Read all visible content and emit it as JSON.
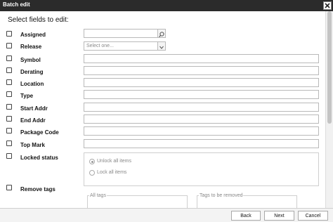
{
  "window": {
    "title": "Batch edit"
  },
  "dialog": {
    "heading": "Select fields to edit:"
  },
  "fields": [
    {
      "label": "Assigned",
      "value": ""
    },
    {
      "label": "Release",
      "placeholder": "Select one..."
    },
    {
      "label": "Symbol",
      "value": ""
    },
    {
      "label": "Derating",
      "value": ""
    },
    {
      "label": "Location",
      "value": ""
    },
    {
      "label": "Type",
      "value": ""
    },
    {
      "label": "Start Addr",
      "value": ""
    },
    {
      "label": "End Addr",
      "value": ""
    },
    {
      "label": "Package Code",
      "value": ""
    },
    {
      "label": "Top Mark",
      "value": ""
    },
    {
      "label": "Locked status"
    },
    {
      "label": "Remove tags"
    }
  ],
  "locked_status": {
    "options": [
      {
        "label": "Unlock all items",
        "selected": true
      },
      {
        "label": "Lock all items",
        "selected": false
      }
    ]
  },
  "tags": {
    "all_tags_label": "All tags",
    "to_remove_label": "Tags to be removed"
  },
  "footer": {
    "back_label": "Back",
    "next_label": "Next",
    "cancel_label": "Cancel"
  },
  "icons": {
    "close": "close-icon",
    "search": "search-icon",
    "dropdown": "chevron-down-icon"
  }
}
